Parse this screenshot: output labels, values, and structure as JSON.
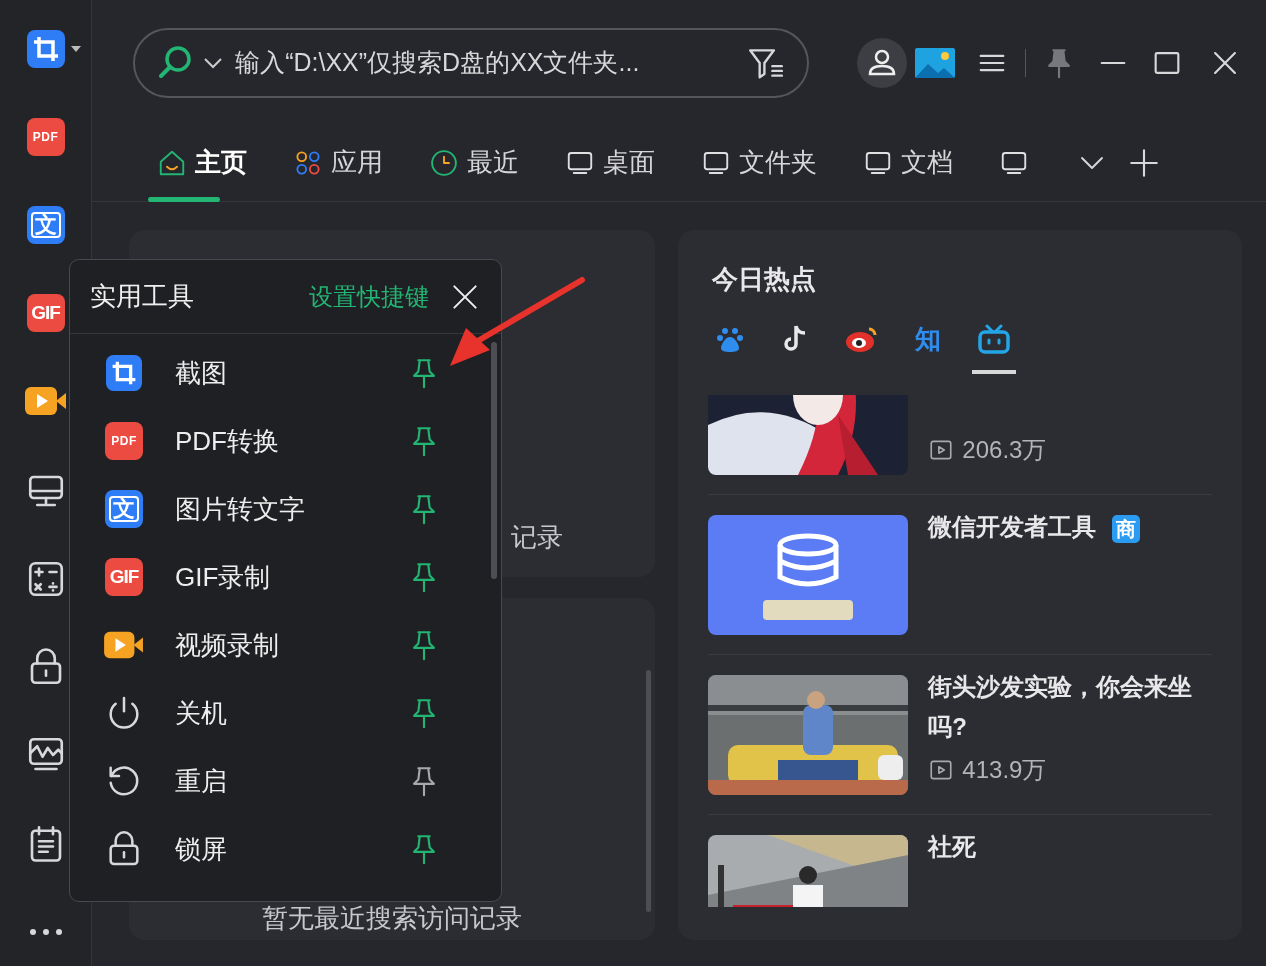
{
  "sidebar": {
    "items": [
      {
        "kind": "crop",
        "has_menu": true
      },
      {
        "kind": "pdf",
        "icon_text": "PDF"
      },
      {
        "kind": "ocr",
        "icon_text": "文"
      },
      {
        "kind": "gif",
        "icon_text": "GIF"
      },
      {
        "kind": "video"
      },
      {
        "kind": "monitor"
      },
      {
        "kind": "calculator"
      },
      {
        "kind": "lock"
      },
      {
        "kind": "pulse"
      },
      {
        "kind": "notepad"
      },
      {
        "kind": "more"
      }
    ]
  },
  "search": {
    "placeholder": "输入“D:\\XX”仅搜索D盘的XX文件夹..."
  },
  "tabs": [
    {
      "label": "主页",
      "kind": "home",
      "selected": true
    },
    {
      "label": "应用",
      "kind": "apps",
      "selected": false
    },
    {
      "label": "最近",
      "kind": "clock",
      "selected": false
    },
    {
      "label": "桌面",
      "kind": "monitor",
      "selected": false
    },
    {
      "label": "文件夹",
      "kind": "monitor",
      "selected": false
    },
    {
      "label": "文档",
      "kind": "monitor",
      "selected": false
    },
    {
      "kind": "monitor",
      "selected": false
    }
  ],
  "frequent_card": {
    "empty_text": "记录"
  },
  "recent_card": {
    "empty_text": "暂无最近搜索访问记录"
  },
  "hot": {
    "title": "今日热点",
    "sources": [
      {
        "kind": "paw",
        "selected": false
      },
      {
        "kind": "note",
        "selected": false
      },
      {
        "kind": "eye",
        "selected": false
      },
      {
        "kind": "text",
        "label": "知",
        "selected": false
      },
      {
        "kind": "tv",
        "selected": true
      }
    ],
    "items": [
      {
        "views": "206.3万"
      },
      {
        "title": "微信开发者工具",
        "badge": "商"
      },
      {
        "title": "街头沙发实验，你会来坐吗?",
        "views": "413.9万"
      },
      {
        "title": "社死"
      }
    ]
  },
  "tools_popup": {
    "title": "实用工具",
    "shortcut_link": "设置快捷键",
    "items": [
      {
        "kind": "crop",
        "label": "截图",
        "pinned": true
      },
      {
        "kind": "pdf",
        "icon_text": "PDF",
        "label": "PDF转换",
        "pinned": true
      },
      {
        "kind": "ocr",
        "icon_text": "文",
        "label": "图片转文字",
        "pinned": true
      },
      {
        "kind": "gif",
        "icon_text": "GIF",
        "label": "GIF录制",
        "pinned": true
      },
      {
        "kind": "video",
        "label": "视频录制",
        "pinned": true
      },
      {
        "kind": "power",
        "label": "关机",
        "pinned": true
      },
      {
        "kind": "restart",
        "label": "重启",
        "pinned": false
      },
      {
        "kind": "lock",
        "label": "锁屏",
        "pinned": true
      }
    ]
  }
}
